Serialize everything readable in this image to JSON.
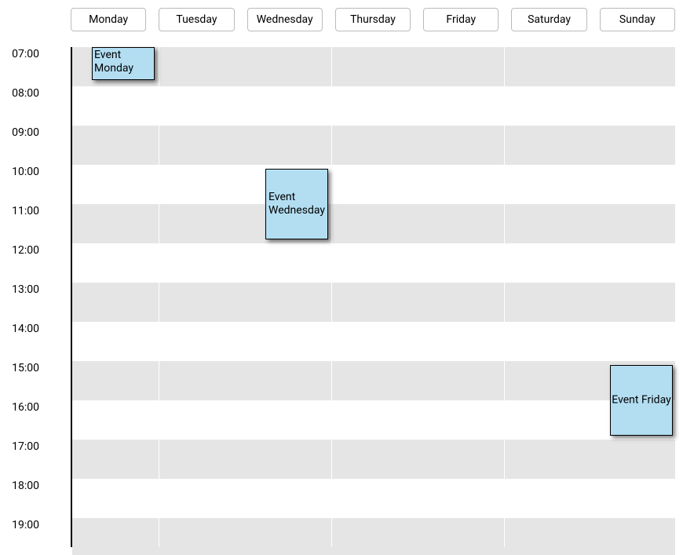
{
  "days": [
    "Monday",
    "Tuesday",
    "Wednesday",
    "Thursday",
    "Friday",
    "Saturday",
    "Sunday"
  ],
  "hours": [
    "07:00",
    "08:00",
    "09:00",
    "10:00",
    "11:00",
    "12:00",
    "13:00",
    "14:00",
    "15:00",
    "16:00",
    "17:00",
    "18:00",
    "19:00"
  ],
  "events": [
    {
      "title": "Event Monday",
      "day": "Monday",
      "start": "07:00",
      "end": "08:00"
    },
    {
      "title": "Event Wednesday",
      "day": "Wednesday",
      "start": "10:00",
      "end": "11:50"
    },
    {
      "title": "Event Friday",
      "day": "Sunday",
      "start": "15:00",
      "end": "16:50"
    }
  ],
  "colors": {
    "event_bg": "#b3def2",
    "alt_row_bg": "#e5e5e5"
  }
}
